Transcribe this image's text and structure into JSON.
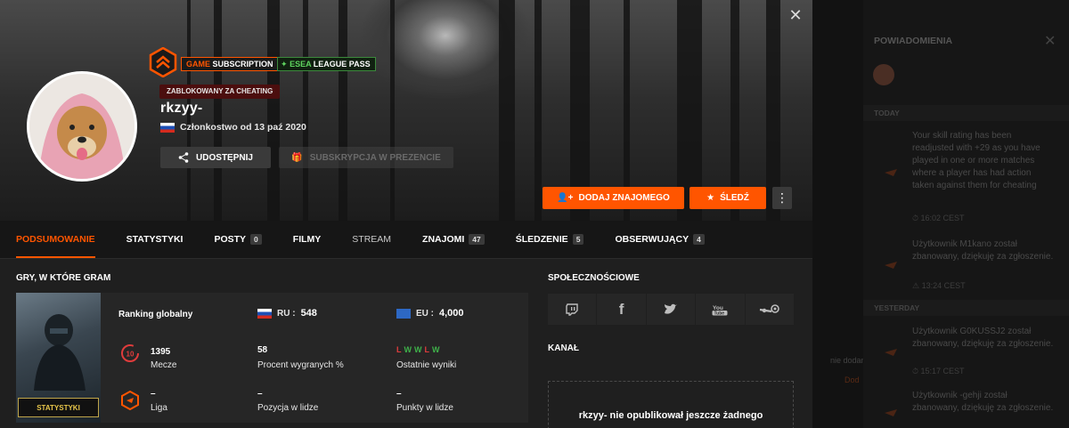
{
  "header": {
    "subscription_prefix": "GAME",
    "subscription_label": "SUBSCRIPTION",
    "esea_prefix": "ESEA",
    "esea_label": "LEAGUE PASS",
    "ban_label": "ZABLOKOWANY ZA CHEATING",
    "username": "rkzyy-",
    "membership": "Członkostwo od 13 paź 2020",
    "share_label": "UDOSTĘPNIJ",
    "gift_label": "SUBSKRYPCJA W PREZENCIE",
    "add_friend_label": "DODAJ ZNAJOMEGO",
    "follow_label": "ŚLEDŹ",
    "close_glyph": "✕"
  },
  "tabs": [
    {
      "label": "PODSUMOWANIE",
      "count": null,
      "active": true
    },
    {
      "label": "STATYSTYKI",
      "count": null
    },
    {
      "label": "POSTY",
      "count": "0"
    },
    {
      "label": "FILMY",
      "count": null
    },
    {
      "label": "STREAM",
      "count": null
    },
    {
      "label": "ZNAJOMI",
      "count": "47"
    },
    {
      "label": "ŚLEDZENIE",
      "count": "5"
    },
    {
      "label": "OBSERWUJĄCY",
      "count": "4"
    }
  ],
  "games": {
    "section_title": "GRY, W KTÓRE GRAM",
    "cover_label": "STATYSTYKI",
    "ranking_label": "Ranking globalny",
    "ru_label": "RU :",
    "ru_value": "548",
    "eu_label": "EU :",
    "eu_value": "4,000",
    "level": "10",
    "matches_value": "1395",
    "matches_label": "Mecze",
    "winrate_value": "58",
    "winrate_label": "Procent wygranych %",
    "recent_results": [
      "L",
      "W",
      "W",
      "L",
      "W"
    ],
    "recent_label": "Ostatnie wyniki",
    "league_value": "–",
    "league_label": "Liga",
    "position_value": "–",
    "position_label": "Pozycja w lidze",
    "points_value": "–",
    "points_label": "Punkty w lidze"
  },
  "social": {
    "section_title": "SPOŁECZNOŚCIOWE",
    "icons": [
      "twitch-icon",
      "facebook-icon",
      "twitter-icon",
      "youtube-icon",
      "steam-icon"
    ],
    "channel_title": "KANAŁ",
    "channel_empty": "rkzyy- nie opublikował jeszcze żadnego"
  },
  "notifications": {
    "title": "POWIADOMIENIA",
    "today_label": "TODAY",
    "yesterday_label": "YESTERDAY",
    "items": [
      {
        "text": "Your skill rating has been readjusted with +29 as you have played in one or more matches where a player has had action taken against them for cheating",
        "time": "16:02 CEST"
      },
      {
        "text": "Użytkownik M1kano został zbanowany, dziękuję za zgłoszenie.",
        "time": "13:24 CEST"
      },
      {
        "text": "Użytkownik G0KUSSJ2 został zbanowany, dziękuję za zgłoszenie.",
        "time": "15:17 CEST"
      },
      {
        "text": "Użytkownik -gehji został zbanowany, dziękuję za zgłoszenie.",
        "time": ""
      }
    ],
    "behind_text_1": "nie dodan",
    "behind_text_2": "Dod"
  },
  "colors": {
    "accent": "#ff5500",
    "win": "#3fb24a",
    "loss": "#e03c3c"
  }
}
